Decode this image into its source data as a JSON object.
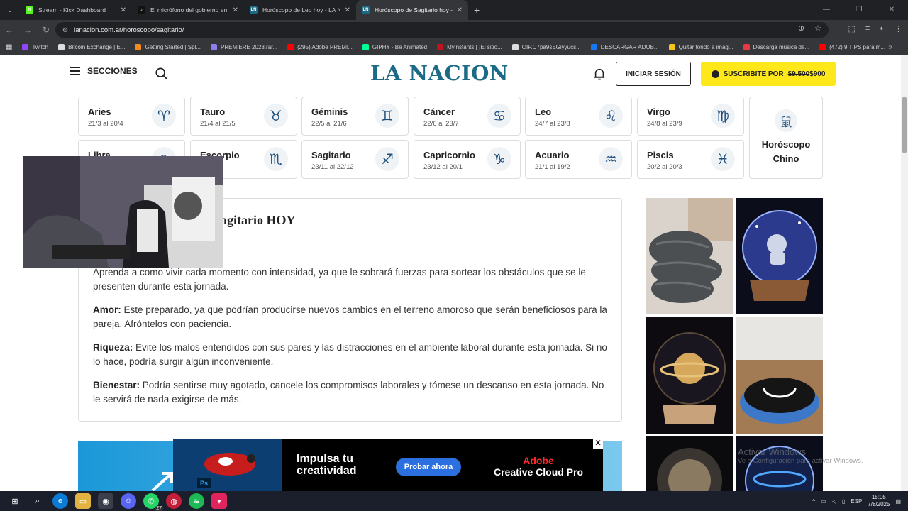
{
  "browser": {
    "tabs": [
      {
        "title": "Stream - Kick Dashboard",
        "color": "#53fc18",
        "letter": "K",
        "active": false
      },
      {
        "title": "El micrófono del gobierno en m",
        "color": "#111111",
        "letter": "♪",
        "active": false
      },
      {
        "title": "Horóscopo de Leo hoy - LA NAC",
        "color": "#1b6a86",
        "letter": "LN",
        "active": false
      },
      {
        "title": "Horóscopo de Sagitario hoy - L",
        "color": "#1b6a86",
        "letter": "LN",
        "active": true
      }
    ],
    "url": "lanacion.com.ar/horoscopo/sagitario/",
    "bookmarks": [
      {
        "label": "Twitch",
        "color": "#9146ff"
      },
      {
        "label": "Bitcoin Exchange | E...",
        "color": "#dddddd"
      },
      {
        "label": "Getting Started | Spl...",
        "color": "#f58a1f"
      },
      {
        "label": "PREMIERE 2023.rar...",
        "color": "#8d7ef0"
      },
      {
        "label": "(295) Adobe PREMI...",
        "color": "#ff0000"
      },
      {
        "label": "GIPHY - Be Animated",
        "color": "#00ff99"
      },
      {
        "label": "Myinstants | ¡El sitio...",
        "color": "#c1121f"
      },
      {
        "label": "OIP.C7pa9sEGiyyucs...",
        "color": "#dddddd"
      },
      {
        "label": "DESCARGAR ADOB...",
        "color": "#1877f2"
      },
      {
        "label": "Quitar fondo a imag...",
        "color": "#f5c518"
      },
      {
        "label": "Descarga música de...",
        "color": "#e63946"
      },
      {
        "label": "(472) 9 TIPS para m...",
        "color": "#ff0000"
      }
    ]
  },
  "site": {
    "menu_label": "SECCIONES",
    "logo": "LA NACION",
    "login_label": "INICIAR SESIÓN",
    "subscribe_prefix": "SUSCRIBITE POR",
    "subscribe_old_price": "$9.500",
    "subscribe_price": "$900"
  },
  "zodiac": [
    {
      "name": "Aries",
      "dates": "21/3 al 20/4",
      "symbol": "♈"
    },
    {
      "name": "Tauro",
      "dates": "21/4 al 21/5",
      "symbol": "♉"
    },
    {
      "name": "Géminis",
      "dates": "22/5 al 21/6",
      "symbol": "♊"
    },
    {
      "name": "Cáncer",
      "dates": "22/6 al 23/7",
      "symbol": "♋"
    },
    {
      "name": "Leo",
      "dates": "24/7 al 23/8",
      "symbol": "♌"
    },
    {
      "name": "Virgo",
      "dates": "24/8 al 23/9",
      "symbol": "♍"
    },
    {
      "name": "Libra",
      "dates": "",
      "symbol": "♎"
    },
    {
      "name": "Escorpio",
      "dates": "22/11",
      "symbol": "♏"
    },
    {
      "name": "Sagitario",
      "dates": "23/11 al 22/12",
      "symbol": "♐"
    },
    {
      "name": "Capricornio",
      "dates": "23/12 al 20/1",
      "symbol": "♑"
    },
    {
      "name": "Acuario",
      "dates": "21/1 al 19/2",
      "symbol": "♒"
    },
    {
      "name": "Piscis",
      "dates": "20/2 al 20/3",
      "symbol": "♓"
    }
  ],
  "chinese": {
    "label": "Horóscopo Chino",
    "symbol": "鼠"
  },
  "article": {
    "title_visible": "agitario HOY",
    "intro": "Aprenda a como vivir cada momento con intensidad, ya que le sobrará fuerzas para sortear los obstáculos que se le presenten durante esta jornada.",
    "sections": [
      {
        "label": "Amor:",
        "text": " Este preparado, ya que podrían producirse nuevos cambios en el terreno amoroso que serán beneficiosos para la pareja. Afróntelos con paciencia."
      },
      {
        "label": "Riqueza:",
        "text": " Evite los malos entendidos con sus pares y las distracciones en el ambiente laboral durante esta jornada. Si no lo hace, podría surgir algún inconveniente."
      },
      {
        "label": "Bienestar:",
        "text": " Podría sentirse muy agotado, cancele los compromisos laborales y tómese un descanso en esta jornada. No le servirá de nada exigirse de más."
      }
    ]
  },
  "ad": {
    "headline_1": "Impulsa tu",
    "headline_2": "creatividad",
    "cta": "Probar ahora",
    "brand_1": "Adobe",
    "brand_2": "Creative Cloud Pro"
  },
  "watermark": {
    "line1": "Activar Windows",
    "line2": "Ve a Configuración para activar Windows."
  },
  "taskbar": {
    "lang": "ESP",
    "time": "15:05",
    "date": "7/8/2025",
    "badge": "27"
  }
}
